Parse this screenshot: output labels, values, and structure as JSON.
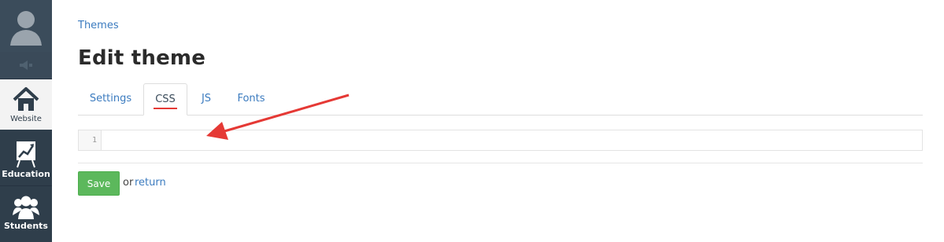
{
  "sidebar": {
    "items": [
      {
        "label": "Website",
        "icon": "home-icon"
      },
      {
        "label": "Education",
        "icon": "chart-board-icon"
      },
      {
        "label": "Students",
        "icon": "users-icon"
      }
    ]
  },
  "breadcrumb": "Themes",
  "page_title": "Edit theme",
  "tabs": [
    {
      "label": "Settings"
    },
    {
      "label": "CSS",
      "active": true
    },
    {
      "label": "JS"
    },
    {
      "label": "Fonts"
    }
  ],
  "editor": {
    "line_number": "1",
    "content": ""
  },
  "actions": {
    "save_label": "Save",
    "or_text": "or",
    "return_label": "return"
  },
  "colors": {
    "accent": "#3b7bbf",
    "sidebar": "#2f3e4b",
    "save": "#5cb85c",
    "annotation": "#e53935"
  }
}
